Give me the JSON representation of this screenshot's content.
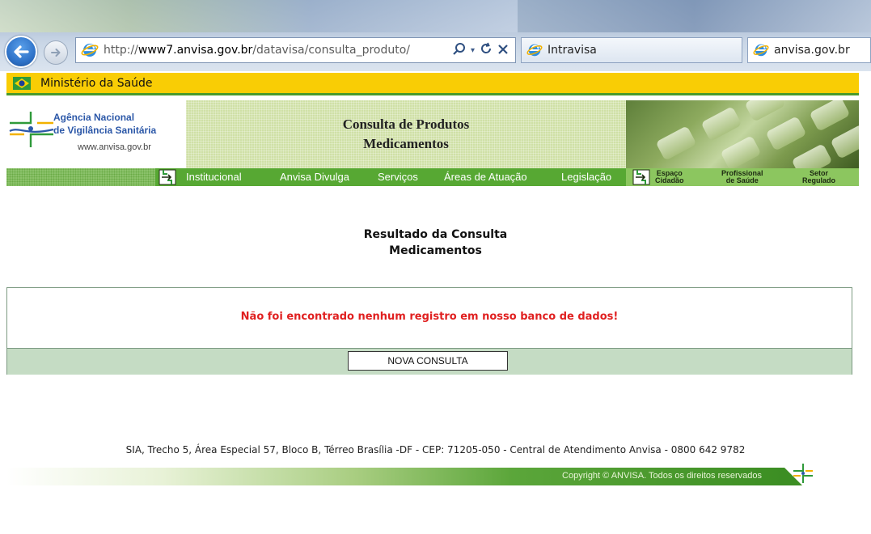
{
  "browser": {
    "url_prefix": "http://",
    "url_domain": "www7.anvisa.gov.br",
    "url_path": "/datavisa/consulta_produto/",
    "tabs": [
      {
        "label": "Intravisa"
      },
      {
        "label": "anvisa.gov.br"
      }
    ]
  },
  "gov_bar": {
    "label": "Ministério da Saúde"
  },
  "logo": {
    "line1": "Agência Nacional",
    "line2": "de Vigilância Sanitária",
    "url": "www.anvisa.gov.br"
  },
  "banner": {
    "title_line1": "Consulta de Produtos",
    "title_line2": "Medicamentos"
  },
  "nav": {
    "items": [
      {
        "label": "Institucional"
      },
      {
        "label": "Anvisa Divulga"
      },
      {
        "label": "Serviços"
      },
      {
        "label": "Áreas de Atuação"
      },
      {
        "label": "Legislação"
      }
    ],
    "right_items": [
      {
        "line1": "Espaço",
        "line2": "Cidadão"
      },
      {
        "line1": "Profissional",
        "line2": "de Saúde"
      },
      {
        "line1": "Setor",
        "line2": "Regulado"
      }
    ]
  },
  "result": {
    "title_line1": "Resultado da Consulta",
    "title_line2": "Medicamentos",
    "message": "Não foi encontrado nenhum registro em nosso banco de dados!",
    "button_label": "NOVA CONSULTA"
  },
  "footer": {
    "address": "SIA, Trecho 5, Área Especial 57, Bloco B, Térreo Brasília -DF - CEP: 71205-050 - Central de Atendimento Anvisa - 0800 642 9782",
    "copyright": "Copyright © ANVISA. Todos os direitos reservados"
  },
  "colors": {
    "gov_yellow": "#f9cd05",
    "nav_green": "#57a833",
    "error_red": "#e02020",
    "result_footer": "#c5dcc4"
  }
}
